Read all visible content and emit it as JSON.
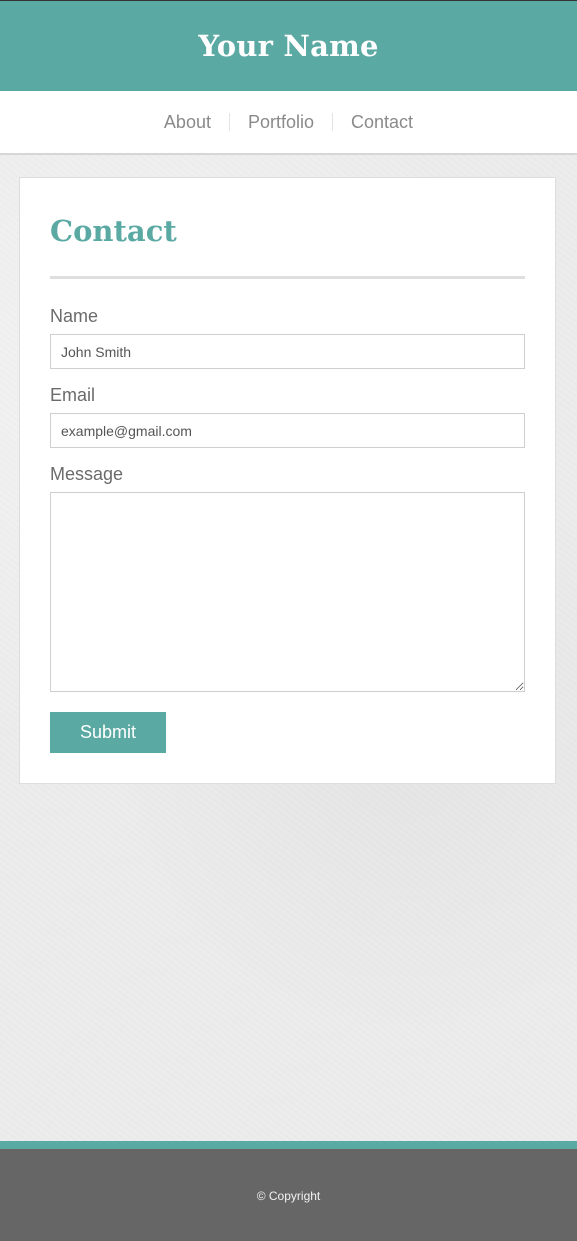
{
  "colors": {
    "accent": "#5aa9a3",
    "nav_text": "#8a8a8a",
    "footer_bg": "#666666"
  },
  "header": {
    "title": "Your Name"
  },
  "nav": {
    "items": [
      {
        "label": "About"
      },
      {
        "label": "Portfolio"
      },
      {
        "label": "Contact"
      }
    ]
  },
  "contact": {
    "title": "Contact",
    "name_label": "Name",
    "name_placeholder": "John Smith",
    "email_label": "Email",
    "email_placeholder": "example@gmail.com",
    "message_label": "Message",
    "message_value": "",
    "submit_label": "Submit"
  },
  "footer": {
    "copyright": "© Copyright"
  }
}
